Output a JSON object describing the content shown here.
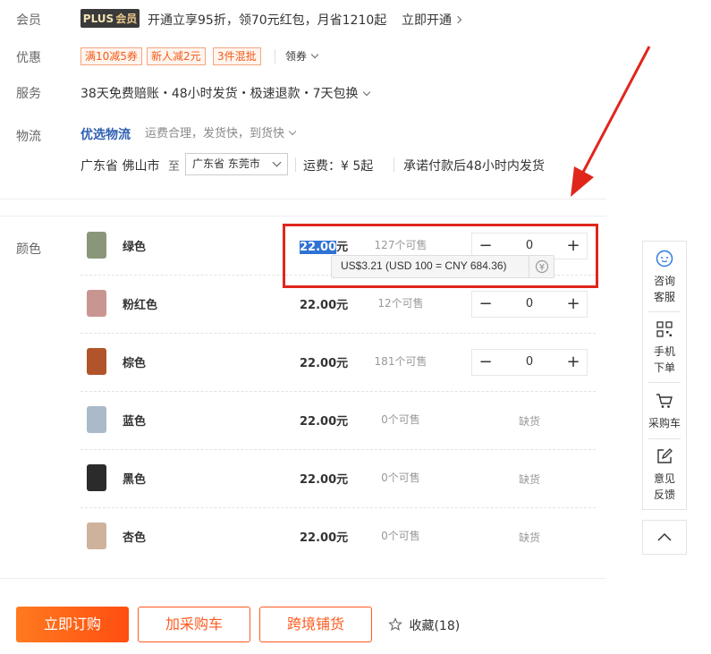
{
  "member": {
    "label": "会员",
    "badge_a": "PLUS",
    "badge_b": "会员",
    "text": "开通立享95折，领70元红包，月省1210起",
    "link": "立即开通"
  },
  "promo": {
    "label": "优惠",
    "coupons": [
      "满10减5券",
      "新人减2元",
      "3件混批"
    ],
    "get_coupon": "领券"
  },
  "service": {
    "label": "服务",
    "text": "38天免费赔账・48小时发货・极速退款・7天包换"
  },
  "logistics": {
    "label": "物流",
    "brand": "优选物流",
    "desc": "运费合理，发货快，到货快",
    "from": "广东省 佛山市",
    "to_label": "至",
    "to_select": "广东省 东莞市",
    "fee": "运费：¥ 5起",
    "promise": "承诺付款后48小时内发货"
  },
  "color": {
    "label": "颜色",
    "items": [
      {
        "name": "绿色",
        "price_num": "22.00",
        "price_unit": "元",
        "stock": "127个可售",
        "qty": "0",
        "soldout": "",
        "swatch": "#8a9679"
      },
      {
        "name": "粉红色",
        "price_num": "22.00",
        "price_unit": "元",
        "stock": "12个可售",
        "qty": "0",
        "soldout": "",
        "swatch": "#c99590"
      },
      {
        "name": "棕色",
        "price_num": "22.00",
        "price_unit": "元",
        "stock": "181个可售",
        "qty": "0",
        "soldout": "",
        "swatch": "#b1542a"
      },
      {
        "name": "蓝色",
        "price_num": "22.00",
        "price_unit": "元",
        "stock": "0个可售",
        "qty": "",
        "soldout": "缺货",
        "swatch": "#aabac8"
      },
      {
        "name": "黑色",
        "price_num": "22.00",
        "price_unit": "元",
        "stock": "0个可售",
        "qty": "",
        "soldout": "缺货",
        "swatch": "#2b2b2b"
      },
      {
        "name": "杏色",
        "price_num": "22.00",
        "price_unit": "元",
        "stock": "0个可售",
        "qty": "",
        "soldout": "缺货",
        "swatch": "#cfb29c"
      }
    ]
  },
  "stepper": {
    "minus": "−",
    "plus": "+"
  },
  "tooltip": {
    "text": "US$3.21 (USD 100 = CNY 684.36)"
  },
  "actions": {
    "buy_now": "立即订购",
    "add_cart": "加采购车",
    "cross_border": "跨境铺货",
    "favorite": "收藏(18)"
  },
  "sidebar": {
    "consult_1": "咨询",
    "consult_2": "客服",
    "mobile_1": "手机",
    "mobile_2": "下单",
    "cart": "采购车",
    "feedback_1": "意见",
    "feedback_2": "反馈"
  },
  "colors": {
    "accent": "#ff5a1f",
    "link": "#2f5fb3",
    "highlight": "#e0261b"
  }
}
